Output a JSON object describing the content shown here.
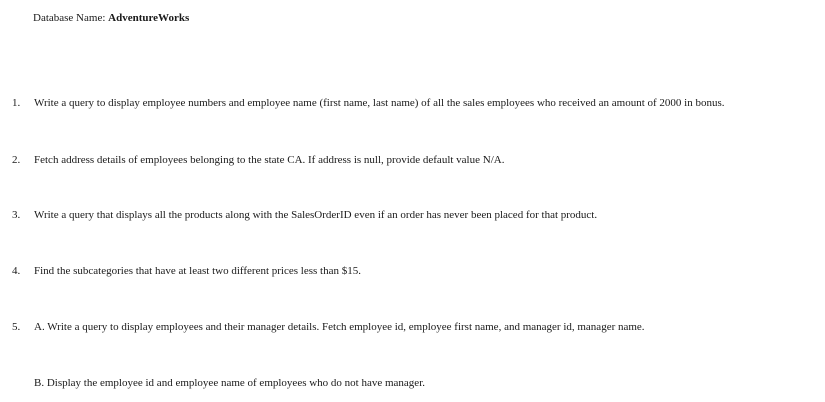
{
  "header": {
    "label": "Database Name:",
    "name": "AdventureWorks"
  },
  "questions": [
    {
      "number": "1.",
      "text": "Write a query to display employee numbers and employee name (first name, last name) of all the sales employees who received an amount of 2000 in bonus."
    },
    {
      "number": "2.",
      "text": "Fetch address details of employees belonging to the state CA. If address is null, provide default value N/A."
    },
    {
      "number": "3.",
      "text": "Write a query that displays all the products along with the SalesOrderID even if an order has never been placed for that product."
    },
    {
      "number": "4.",
      "text": "Find the subcategories that have at least two different prices less than $15."
    },
    {
      "number": "5.",
      "text": "A. Write a query to display employees and their manager details. Fetch employee id,   employee first name, and manager id, manager name.",
      "sub": "B. Display the employee id and employee name of employees who do not have manager."
    }
  ]
}
